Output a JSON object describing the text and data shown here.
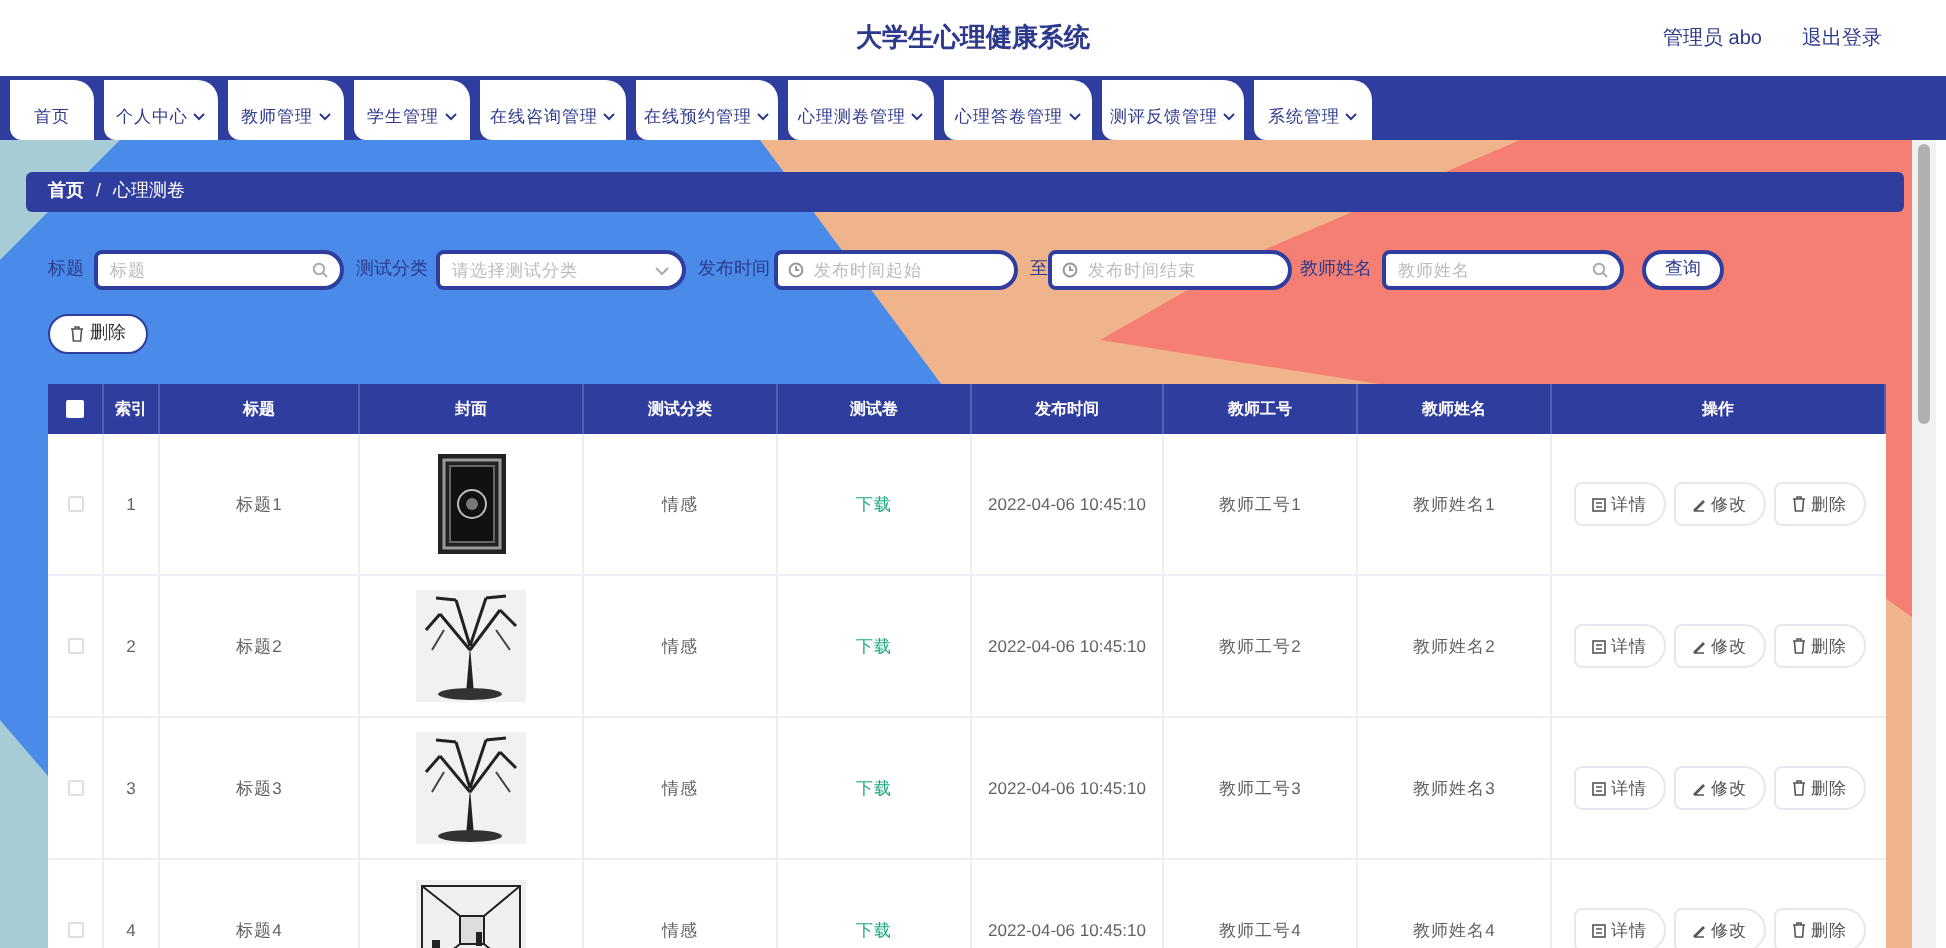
{
  "header": {
    "title": "大学生心理健康系统",
    "user": "管理员 abo",
    "logout": "退出登录"
  },
  "nav": [
    {
      "label": "首页",
      "kind": "link"
    },
    {
      "label": "个人中心",
      "kind": "menu"
    },
    {
      "label": "教师管理",
      "kind": "menu"
    },
    {
      "label": "学生管理",
      "kind": "menu"
    },
    {
      "label": "在线咨询管理",
      "kind": "menu"
    },
    {
      "label": "在线预约管理",
      "kind": "menu"
    },
    {
      "label": "心理测卷管理",
      "kind": "menu"
    },
    {
      "label": "心理答卷管理",
      "kind": "menu"
    },
    {
      "label": "测评反馈管理",
      "kind": "menu"
    },
    {
      "label": "系统管理",
      "kind": "menu"
    }
  ],
  "breadcrumb": [
    "首页",
    "/",
    "心理测卷"
  ],
  "filters": [
    {
      "label": "标题",
      "kind": "search",
      "placeholder": "标题"
    },
    {
      "label": "测试分类",
      "kind": "select",
      "placeholder": "请选择测试分类"
    },
    {
      "label": "发布时间",
      "kind": "date",
      "placeholder": "发布时间起始"
    },
    {
      "label": "至",
      "kind": "date",
      "placeholder": "发布时间结束"
    },
    {
      "label": "教师姓名",
      "kind": "search",
      "placeholder": "教师姓名"
    }
  ],
  "search_button": "查询",
  "delete_button": "删除",
  "table": {
    "select_all_checked": false,
    "columns": [
      "索引",
      "标题",
      "封面",
      "测试分类",
      "测试卷",
      "发布时间",
      "教师工号",
      "教师姓名",
      "操作"
    ],
    "rows": [
      {
        "checked": false,
        "index": "1",
        "title": "标题1",
        "cover": {
          "kind": "picture"
        },
        "category": "情感",
        "paper": "下载",
        "time": "2022-04-06 10:45:10",
        "teacher_id": "教师工号1",
        "teacher_name": "教师姓名1",
        "actions": [
          "详情",
          "修改",
          "删除"
        ]
      },
      {
        "checked": false,
        "index": "2",
        "title": "标题2",
        "cover": {
          "kind": "picture"
        },
        "category": "情感",
        "paper": "下载",
        "time": "2022-04-06 10:45:10",
        "teacher_id": "教师工号2",
        "teacher_name": "教师姓名2",
        "actions": [
          "详情",
          "修改",
          "删除"
        ]
      },
      {
        "checked": false,
        "index": "3",
        "title": "标题3",
        "cover": {
          "kind": "picture"
        },
        "category": "情感",
        "paper": "下载",
        "time": "2022-04-06 10:45:10",
        "teacher_id": "教师工号3",
        "teacher_name": "教师姓名3",
        "actions": [
          "详情",
          "修改",
          "删除"
        ]
      },
      {
        "checked": false,
        "index": "4",
        "title": "标题4",
        "cover": {
          "kind": "picture"
        },
        "category": "情感",
        "paper": "下载",
        "time": "2022-04-06 10:45:10",
        "teacher_id": "教师工号4",
        "teacher_name": "教师姓名4",
        "actions": [
          "详情",
          "修改",
          "删除"
        ]
      }
    ]
  }
}
